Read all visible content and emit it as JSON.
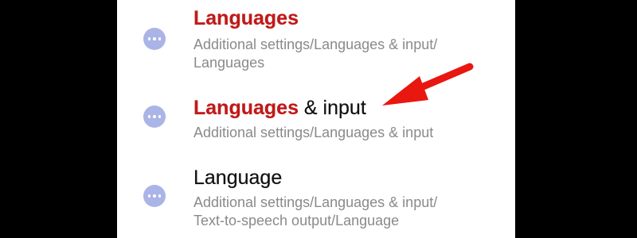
{
  "results": [
    {
      "title_highlight": "Languages",
      "title_rest": "",
      "path_line1": "Additional settings/Languages & input/",
      "path_line2": "Languages"
    },
    {
      "title_highlight": "Languages",
      "title_rest": " & input",
      "path_line1": "Additional settings/Languages & input",
      "path_line2": ""
    },
    {
      "title_highlight": "",
      "title_rest": "Language",
      "path_line1": "Additional settings/Languages & input/",
      "path_line2": "Text-to-speech output/Language"
    }
  ],
  "colors": {
    "highlight": "#c01a1a",
    "icon": "#aab4e6",
    "arrow": "#e8170f",
    "background": "#000000"
  },
  "icons": {
    "result_icon": "more-dots-icon",
    "annotation": "red-arrow-icon"
  }
}
